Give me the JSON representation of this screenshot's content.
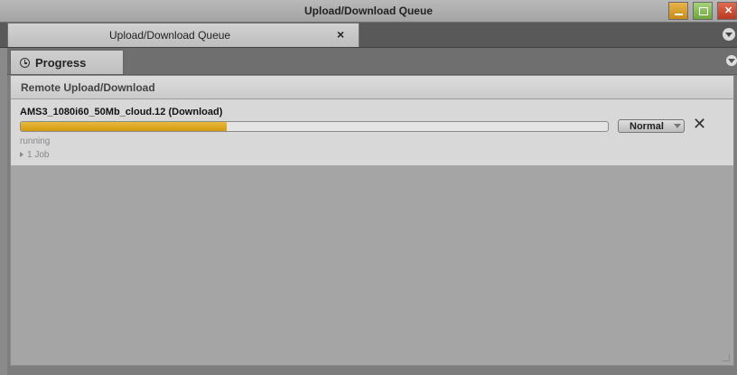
{
  "window": {
    "title": "Upload/Download Queue"
  },
  "doc_tab": {
    "label": "Upload/Download Queue",
    "close_glyph": "×"
  },
  "progress_tab": {
    "label": "Progress"
  },
  "section": {
    "header": "Remote Upload/Download"
  },
  "job": {
    "name": "AMS3_1080i60_50Mb_cloud.12 (Download)",
    "progress_fraction": 0.35,
    "priority": "Normal",
    "cancel_glyph": "✕",
    "status": "running",
    "jobs_count_label": "1 Job"
  },
  "colors": {
    "progress_fill": "#d9a020",
    "title_bar": "#adadad",
    "panel_bg": "#a5a5a5"
  },
  "icons": [
    "clock-icon",
    "close-icon",
    "minimize-icon",
    "maximize-icon",
    "panel-menu-icon",
    "dropdown-arrow-icon",
    "expand-caret-icon"
  ]
}
